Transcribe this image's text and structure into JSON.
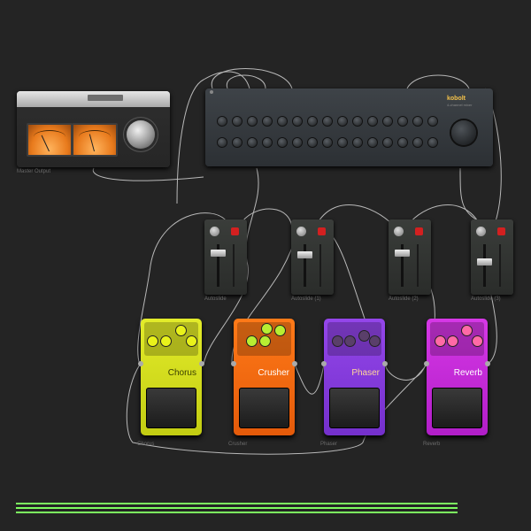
{
  "devices": {
    "master": {
      "label": "Master Output",
      "knob_label": "BRIGHTNESS"
    },
    "mixer": {
      "brand": "kobolt",
      "subtitle": "4-channel mixer"
    },
    "autoslides": [
      {
        "label": "Autoslide"
      },
      {
        "label": "Autoslide (1)"
      },
      {
        "label": "Autoslide (2)"
      },
      {
        "label": "Autoslide (3)"
      }
    ],
    "pedals": [
      {
        "name": "Chorus",
        "label": "Chorus",
        "color": "#d7e11f"
      },
      {
        "name": "Crusher",
        "label": "Crusher",
        "color": "#f06a12"
      },
      {
        "name": "Phaser",
        "label": "Phaser",
        "color": "#8a3fe0"
      },
      {
        "name": "Reverb",
        "label": "Reverb",
        "color": "#c22ad6"
      }
    ]
  },
  "colors": {
    "background": "#242424",
    "accent_lines": "#7dfc60"
  }
}
